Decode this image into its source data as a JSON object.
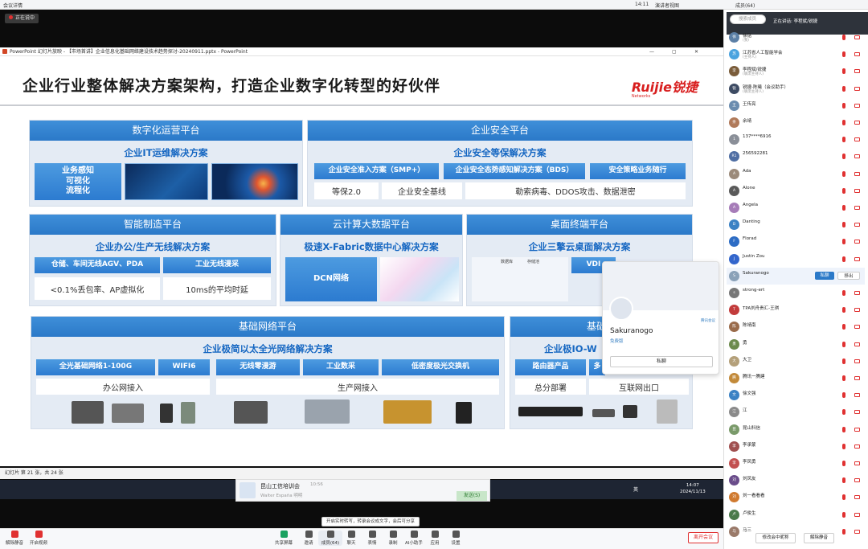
{
  "meeting": {
    "details": "会议详情",
    "time": "14:11",
    "view_mode": "演讲者视图",
    "members_label": "成员(64)",
    "speaking_now": "正在讲话: 李程斌/锐捷",
    "speaking_btn": "正在说中"
  },
  "ppt": {
    "window_title": "PowerPoint 幻灯片放映 - 【市场首讲】企业信息化基础网络建设技术趋势探讨-20240911.pptx - PowerPoint",
    "status": "幻灯片 第 21 张，共 24 张"
  },
  "slide": {
    "title": "企业行业整体解决方案架构，打造企业数字化转型的好伙伴",
    "brand": "Ruijie锐捷",
    "brand_sub": "Networks",
    "panels": {
      "digital": {
        "head": "数字化运营平台",
        "sub": "企业IT运维解决方案",
        "block": "业务感知\n可视化\n流程化"
      },
      "security": {
        "head": "企业安全平台",
        "sub": "企业安全等保解决方案",
        "b1": "企业安全准入方案（SMP+）",
        "b2": "企业安全态势感知解决方案（BDS）",
        "b3": "安全策略业务随行",
        "w1": "等保2.0",
        "w2": "企业安全基线",
        "w3": "勒索病毒、DDOS攻击、数据泄密"
      },
      "manufacturing": {
        "head": "智能制造平台",
        "sub": "企业办公/生产无线解决方案",
        "b1": "仓储、车间无线AGV、PDA",
        "b2": "工业无线漫采",
        "w1": "<0.1%丢包率、AP虚拟化",
        "w2": "10ms的平均时延"
      },
      "cloud": {
        "head": "云计算大数据平台",
        "sub": "极速X-Fabric数据中心解决方案",
        "block": "DCN网络"
      },
      "desktop": {
        "head": "桌面终端平台",
        "sub": "企业三擎云桌面解决方案",
        "vdi": "VDI",
        "l1": "数据库",
        "l2": "存储池",
        "l3": "云终端平台"
      },
      "network": {
        "head": "基础网络平台",
        "sub": "企业极简以太全光网络解决方案",
        "b1": "全光基础网络1-100G",
        "b2": "WIFI6",
        "b3": "无线零漫游",
        "b4": "工业数采",
        "b5": "低密度极光交换机",
        "w1": "办公网接入",
        "w2": "生产网接入"
      },
      "network2": {
        "head": "基础网",
        "sub": "企业极IO-W",
        "b1": "路由器产品",
        "b2": "多",
        "w1": "总分部署",
        "w2": "互联网出口"
      }
    }
  },
  "notification": {
    "title": "昆山工信培训会",
    "time": "10:56",
    "line": "Walter España 明明",
    "action": "发送(S)"
  },
  "taskbar": {
    "time": "14:07",
    "date": "2024/11/13",
    "ime": "英"
  },
  "tooltip": "开启实时转写，转录会议成文字，会后可分享",
  "toolbar": {
    "mute": "解除静音",
    "video": "开启视频",
    "share": "共享屏幕",
    "invite": "邀请",
    "members": "成员(64)",
    "chat": "聊天",
    "react": "表情",
    "record": "录制",
    "ai": "AI小助手",
    "apps": "应用",
    "settings": "设置",
    "leave": "离开会议"
  },
  "right_panel": {
    "search_placeholder": "搜索成员",
    "members": [
      {
        "name": "徐铭",
        "role": "(我)",
        "avatar": "徐"
      },
      {
        "name": "江苏省人工智能学会",
        "role": "(主持人)",
        "avatar": "苏"
      },
      {
        "name": "李程斌/锐捷",
        "role": "(联席主持人)",
        "avatar": "李"
      },
      {
        "name": "锐捷-陈曦（会议助手）",
        "role": "(联席主持人)",
        "avatar": "锐"
      },
      {
        "name": "王传亮",
        "role": "",
        "avatar": "王"
      },
      {
        "name": "余靖",
        "role": "",
        "avatar": "余"
      },
      {
        "name": "137****6916",
        "role": "",
        "avatar": "1"
      },
      {
        "name": "256592281",
        "role": "",
        "avatar": "R1"
      },
      {
        "name": "Ada",
        "role": "",
        "avatar": "A"
      },
      {
        "name": "Alone",
        "role": "",
        "avatar": "A"
      },
      {
        "name": "Angela",
        "role": "",
        "avatar": "A"
      },
      {
        "name": "Danting",
        "role": "",
        "avatar": "D"
      },
      {
        "name": "Florad",
        "role": "",
        "avatar": "F"
      },
      {
        "name": "Justin Zou",
        "role": "",
        "avatar": "J"
      },
      {
        "name": "Sakuranogo",
        "role": "",
        "avatar": "S"
      },
      {
        "name": "strong-ert",
        "role": "",
        "avatar": "s"
      },
      {
        "name": "TPA刘舟贵汇-王琪",
        "role": "",
        "avatar": "T"
      },
      {
        "name": "陈靖南",
        "role": "",
        "avatar": "陈"
      },
      {
        "name": "勇",
        "role": "",
        "avatar": "勇"
      },
      {
        "name": "大卫",
        "role": "",
        "avatar": "大"
      },
      {
        "name": "腾讯一腾建",
        "role": "",
        "avatar": "腾"
      },
      {
        "name": "徐文强",
        "role": "",
        "avatar": "文"
      },
      {
        "name": "江",
        "role": "",
        "avatar": "江"
      },
      {
        "name": "昆山科信",
        "role": "",
        "avatar": "昆"
      },
      {
        "name": "李承蒙",
        "role": "",
        "avatar": "李"
      },
      {
        "name": "李凤勇",
        "role": "",
        "avatar": "李"
      },
      {
        "name": "刘凤友",
        "role": "",
        "avatar": "刘"
      },
      {
        "name": "刘一看看看",
        "role": "",
        "avatar": "刘"
      },
      {
        "name": "卢俊生",
        "role": "",
        "avatar": "卢"
      },
      {
        "name": "马三",
        "role": "",
        "avatar": "马"
      }
    ],
    "private_chat": "私聊",
    "remove_from_meeting": "移出",
    "modify_name": "修改会中昵称",
    "unmute_all": "解除静音"
  },
  "popup": {
    "name": "Sakuranogo",
    "status": "免费版",
    "message": "私聊",
    "badge": "腾讯会议"
  },
  "colors": {
    "accent": "#2b79c8",
    "danger": "#e03131",
    "brand": "#d81e1e"
  }
}
